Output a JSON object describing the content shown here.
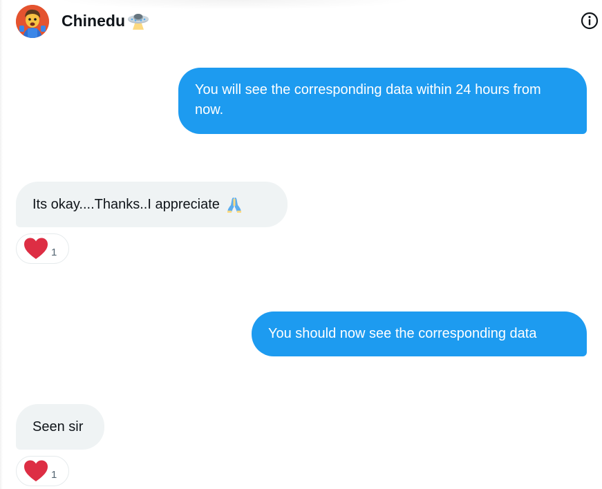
{
  "header": {
    "contact_name": "Chinedu",
    "name_emoji": "ufo-emoji",
    "info_icon": "info-icon"
  },
  "messages": [
    {
      "direction": "outgoing",
      "text": "You will see the corresponding data within 24 hours from now."
    },
    {
      "direction": "incoming",
      "text": "Its okay....Thanks..I appreciate",
      "emoji": "folded-hands-emoji",
      "reaction": {
        "icon": "heart-icon",
        "count": "1"
      }
    },
    {
      "direction": "outgoing",
      "text": "You should now see the corresponding data"
    },
    {
      "direction": "incoming",
      "text": "Seen sir",
      "reaction": {
        "icon": "heart-icon",
        "count": "1"
      }
    }
  ],
  "colors": {
    "outgoing_bubble": "#1d9bf0",
    "incoming_bubble": "#eff3f4",
    "reaction_heart": "#dd2e44",
    "text_primary": "#0f1419",
    "text_secondary": "#536471"
  }
}
